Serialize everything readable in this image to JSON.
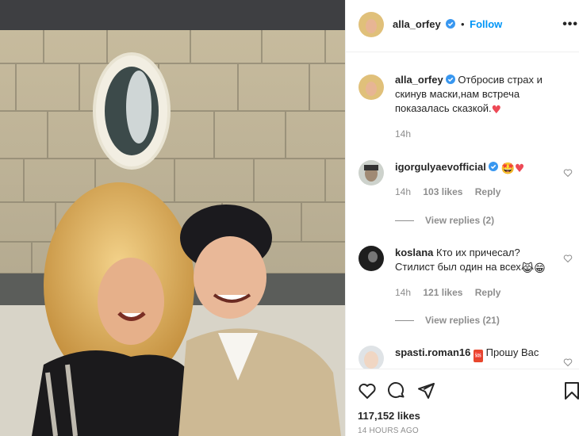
{
  "post": {
    "author": "alla_orfey",
    "follow_label": "Follow",
    "more_label": "•••",
    "caption_text": "Отбросив страх и скинув маски,нам встреча показалась сказкой.",
    "caption_emoji": "♥",
    "caption_time": "14h"
  },
  "comments": [
    {
      "username": "igorgulyaevofficial",
      "verified": true,
      "text": "",
      "emoji": "🤩♥",
      "time": "14h",
      "likes": "103 likes",
      "reply_label": "Reply",
      "view_replies": "View replies (2)"
    },
    {
      "username": "koslana",
      "verified": false,
      "text": "Кто их причесал? Стилист был один на всех",
      "emoji": "😹😁",
      "time": "14h",
      "likes": "121 likes",
      "reply_label": "Reply",
      "view_replies": "View replies (21)"
    },
    {
      "username": "spasti.roman16",
      "verified": false,
      "text": "Прошу Вас",
      "emoji": "🆘",
      "time": "",
      "likes": "",
      "reply_label": "",
      "view_replies": ""
    }
  ],
  "actions": {
    "like_icon": "heart-outline-icon",
    "comment_icon": "comment-icon",
    "share_icon": "paper-plane-icon",
    "save_icon": "bookmark-icon"
  },
  "stats": {
    "likes": "117,152 likes",
    "time_ago": "14 HOURS AGO"
  },
  "colors": {
    "accent": "#0095f6",
    "heart_red": "#ed4956",
    "muted": "#8e8e8e"
  }
}
